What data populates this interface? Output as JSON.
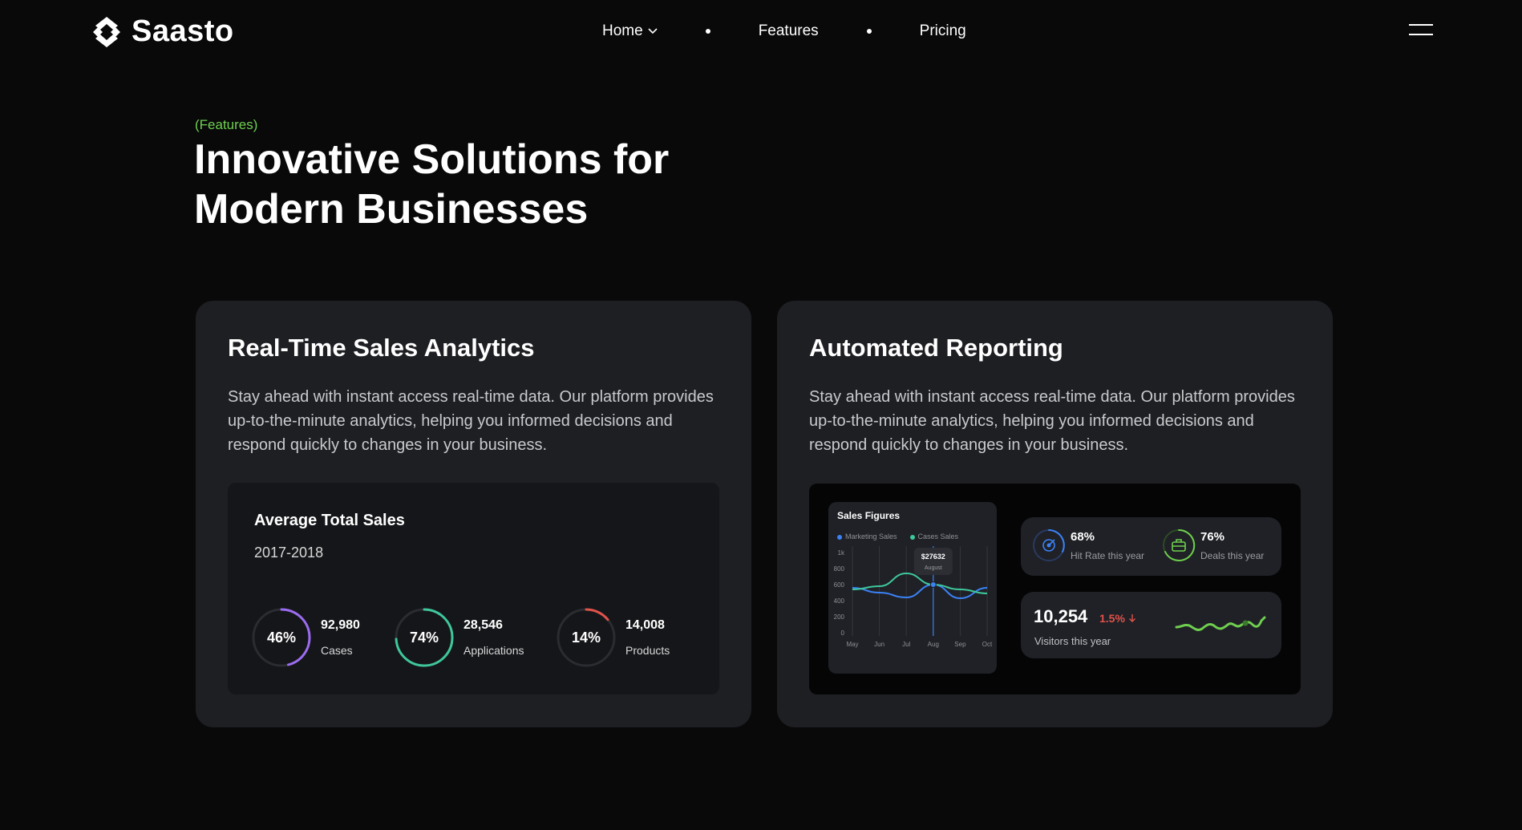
{
  "brand": {
    "name": "Saasto"
  },
  "nav": {
    "items": [
      {
        "label": "Home",
        "icon": "chevron-down-icon"
      },
      {
        "label": "Features"
      },
      {
        "label": "Pricing"
      }
    ]
  },
  "section": {
    "eyebrow": "(Features)",
    "headline_line1": "Innovative Solutions for",
    "headline_line2": "Modern Businesses"
  },
  "cards": [
    {
      "title": "Real-Time Sales Analytics",
      "description": "Stay ahead with instant access real-time data. Our platform provides up-to-the-minute analytics, helping you informed decisions and respond quickly to changes in your business.",
      "widget": {
        "title": "Average Total Sales",
        "subtitle": "2017-2018",
        "stats": [
          {
            "percent": "46%",
            "fraction": 0.46,
            "value": "92,980",
            "label": "Cases",
            "color": "#9b6cf0"
          },
          {
            "percent": "74%",
            "fraction": 0.74,
            "value": "28,546",
            "label": "Applications",
            "color": "#3fc79b"
          },
          {
            "percent": "14%",
            "fraction": 0.14,
            "value": "14,008",
            "label": "Products",
            "color": "#e0524a"
          }
        ]
      }
    },
    {
      "title": "Automated Reporting",
      "description": "Stay ahead with instant access real-time data. Our platform provides up-to-the-minute analytics, helping you informed decisions and respond quickly to changes in your business.",
      "sales_figures": {
        "title": "Sales Figures",
        "legend": [
          {
            "name": "Marketing Sales",
            "color": "#3b82f6"
          },
          {
            "name": "Cases Sales",
            "color": "#3fc79b"
          }
        ],
        "tooltip_value": "$27632",
        "tooltip_month": "August"
      },
      "kpis": [
        {
          "value": "68%",
          "label": "Hit Rate this year",
          "icon": "target-icon",
          "color": "#3b82f6"
        },
        {
          "value": "76%",
          "label": "Deals this year",
          "icon": "briefcase-icon",
          "color": "#6fcf4f"
        }
      ],
      "visitors": {
        "value": "10,254",
        "change": "1.5%",
        "change_icon": "arrow-down-icon",
        "label": "Visitors this year"
      }
    }
  ],
  "chart_data": {
    "type": "line",
    "title": "Sales Figures",
    "x": [
      "May",
      "Jun",
      "Jul",
      "Aug",
      "Sep",
      "Oct"
    ],
    "yticks": [
      "1k",
      "800",
      "600",
      "400",
      "200",
      "0"
    ],
    "ylim": [
      0,
      1000
    ],
    "grid": true,
    "legend_position": "top-left",
    "series": [
      {
        "name": "Marketing Sales",
        "color": "#3b82f6",
        "values": [
          560,
          500,
          440,
          600,
          430,
          560
        ]
      },
      {
        "name": "Cases Sales",
        "color": "#3fc79b",
        "values": [
          540,
          580,
          740,
          600,
          540,
          490
        ]
      }
    ]
  }
}
